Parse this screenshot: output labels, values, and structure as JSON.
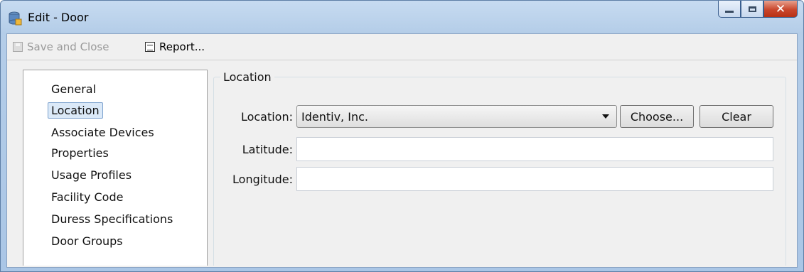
{
  "window": {
    "title": "Edit - Door"
  },
  "toolbar": {
    "save_close_label": "Save and Close",
    "report_label": "Report..."
  },
  "nav": {
    "items": [
      {
        "label": "General"
      },
      {
        "label": "Location",
        "selected": true
      },
      {
        "label": "Associate Devices"
      },
      {
        "label": "Properties"
      },
      {
        "label": "Usage Profiles"
      },
      {
        "label": "Facility Code"
      },
      {
        "label": "Duress Specifications"
      },
      {
        "label": "Door Groups"
      }
    ]
  },
  "location_group": {
    "title": "Location",
    "location_label": "Location:",
    "location_value": "Identiv, Inc.",
    "choose_label": "Choose...",
    "clear_label": "Clear",
    "latitude_label": "Latitude:",
    "latitude_value": "",
    "longitude_label": "Longitude:",
    "longitude_value": ""
  },
  "icons": {
    "app": "database-icon",
    "save": "floppy-disk-icon",
    "report": "report-icon"
  },
  "colors": {
    "close_button": "#c9462c",
    "selection": "#dbe9f8"
  }
}
